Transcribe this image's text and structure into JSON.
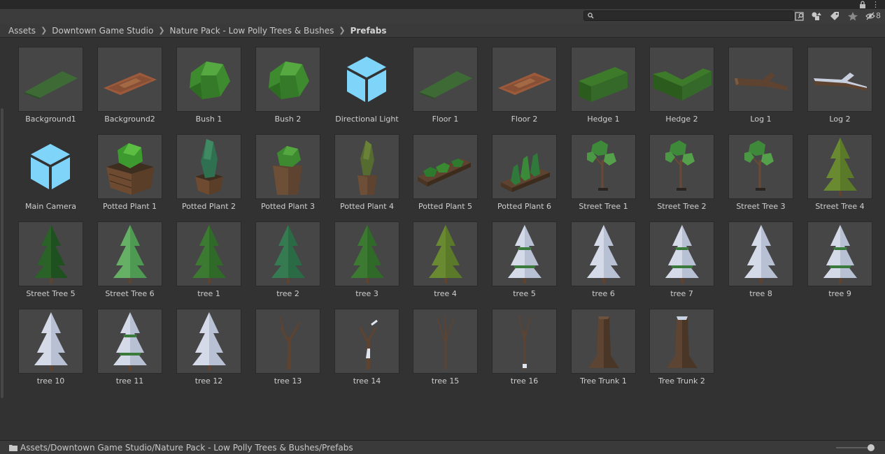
{
  "toolbar": {
    "search_placeholder": "",
    "hidden_count": "8"
  },
  "breadcrumb": {
    "items": [
      "Assets",
      "Downtown Game Studio",
      "Nature Pack - Low Polly Trees & Bushes",
      "Prefabs"
    ]
  },
  "assets": [
    {
      "label": "Background1",
      "icon": "ground-plane-green"
    },
    {
      "label": "Background2",
      "icon": "ground-plane-dirt"
    },
    {
      "label": "Bush 1",
      "icon": "bush"
    },
    {
      "label": "Bush 2",
      "icon": "bush"
    },
    {
      "label": "Directional Light",
      "icon": "prefab-cube-icon"
    },
    {
      "label": "Floor 1",
      "icon": "ground-plane-green"
    },
    {
      "label": "Floor 2",
      "icon": "ground-plane-dirt"
    },
    {
      "label": "Hedge 1",
      "icon": "hedge-straight"
    },
    {
      "label": "Hedge 2",
      "icon": "hedge-corner"
    },
    {
      "label": "Log 1",
      "icon": "log"
    },
    {
      "label": "Log 2",
      "icon": "log-snow"
    },
    {
      "label": "Main Camera",
      "icon": "prefab-cube-icon"
    },
    {
      "label": "Potted Plant 1",
      "icon": "planter-crate"
    },
    {
      "label": "Potted Plant 2",
      "icon": "planter-tall"
    },
    {
      "label": "Potted Plant 3",
      "icon": "pot-round"
    },
    {
      "label": "Potted Plant 4",
      "icon": "pot-cypress"
    },
    {
      "label": "Potted Plant 5",
      "icon": "planter-long"
    },
    {
      "label": "Potted Plant 6",
      "icon": "planter-cypress"
    },
    {
      "label": "Street Tree 1",
      "icon": "street-tree"
    },
    {
      "label": "Street Tree 2",
      "icon": "street-tree"
    },
    {
      "label": "Street Tree 3",
      "icon": "street-tree"
    },
    {
      "label": "Street Tree 4",
      "icon": "pine-olive"
    },
    {
      "label": "Street Tree 5",
      "icon": "pine-dark"
    },
    {
      "label": "Street Tree 6",
      "icon": "pine-light"
    },
    {
      "label": "tree 1",
      "icon": "pine-green"
    },
    {
      "label": "tree 2",
      "icon": "pine-teal"
    },
    {
      "label": "tree 3",
      "icon": "pine-green"
    },
    {
      "label": "tree 4",
      "icon": "pine-olive"
    },
    {
      "label": "tree 5",
      "icon": "pine-snow-green"
    },
    {
      "label": "tree 6",
      "icon": "pine-snow"
    },
    {
      "label": "tree 7",
      "icon": "pine-snow-green"
    },
    {
      "label": "tree 8",
      "icon": "pine-snow"
    },
    {
      "label": "tree 9",
      "icon": "pine-snow-green"
    },
    {
      "label": "tree 10",
      "icon": "pine-snow"
    },
    {
      "label": "tree 11",
      "icon": "pine-snow-green"
    },
    {
      "label": "tree 12",
      "icon": "pine-snow"
    },
    {
      "label": "tree 13",
      "icon": "bare-tree"
    },
    {
      "label": "tree 14",
      "icon": "bare-tree-snow"
    },
    {
      "label": "tree 15",
      "icon": "bare-tree-thin"
    },
    {
      "label": "tree 16",
      "icon": "bare-tree-thin-snow"
    },
    {
      "label": "Tree Trunk 1",
      "icon": "tree-trunk"
    },
    {
      "label": "Tree Trunk 2",
      "icon": "tree-trunk-snow"
    }
  ],
  "footer": {
    "path": "Assets/Downtown Game Studio/Nature Pack - Low Polly Trees & Bushes/Prefabs",
    "zoom_level": 1.0
  },
  "colors": {
    "background": "#323232",
    "thumb_bg": "#464646",
    "prefab_icon": "#7fd4fa"
  }
}
